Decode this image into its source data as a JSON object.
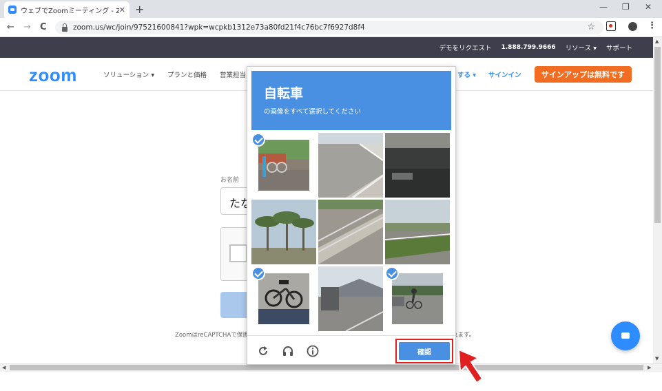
{
  "browser": {
    "tab_title": "ウェブでZoomミーティング - Zoom",
    "tab_close": "✕",
    "new_tab": "+",
    "url": "zoom.us/wc/join/97521600841?wpk=wcpkb1312e73a80fd21f4c76bc7f6927d8f4",
    "win_min": "—",
    "win_restore": "❐",
    "win_close": "✕",
    "back": "←",
    "forward": "→",
    "reload": "C",
    "bookmark": "☆",
    "menu": "⋮"
  },
  "topbar": {
    "demo": "デモをリクエスト",
    "phone": "1.888.799.9666",
    "resources": "リソース ▾",
    "support": "サポート"
  },
  "nav": {
    "logo": "zoom",
    "solutions": "ソリューション ▾",
    "plans": "プランと価格",
    "sales": "営業担当",
    "host": "する ▾",
    "signin": "サインイン",
    "signup": "サインアップは無料です"
  },
  "form": {
    "name_label": "お名前",
    "name_value": "たな",
    "footnote_left": "ZoomはreCAPTCHAで保護",
    "footnote_right": "れます。"
  },
  "captcha": {
    "title": "自転車",
    "subtitle": "の画像をすべて選択してください",
    "verify_label": "確認",
    "tiles": [
      {
        "selected": true
      },
      {
        "selected": false
      },
      {
        "selected": false
      },
      {
        "selected": false
      },
      {
        "selected": false
      },
      {
        "selected": false
      },
      {
        "selected": true
      },
      {
        "selected": false
      },
      {
        "selected": true
      }
    ]
  },
  "colors": {
    "zoom_blue": "#2d8cff",
    "signup_orange": "#f26d21",
    "captcha_blue": "#4a90e2",
    "highlight_red": "#e02020"
  }
}
